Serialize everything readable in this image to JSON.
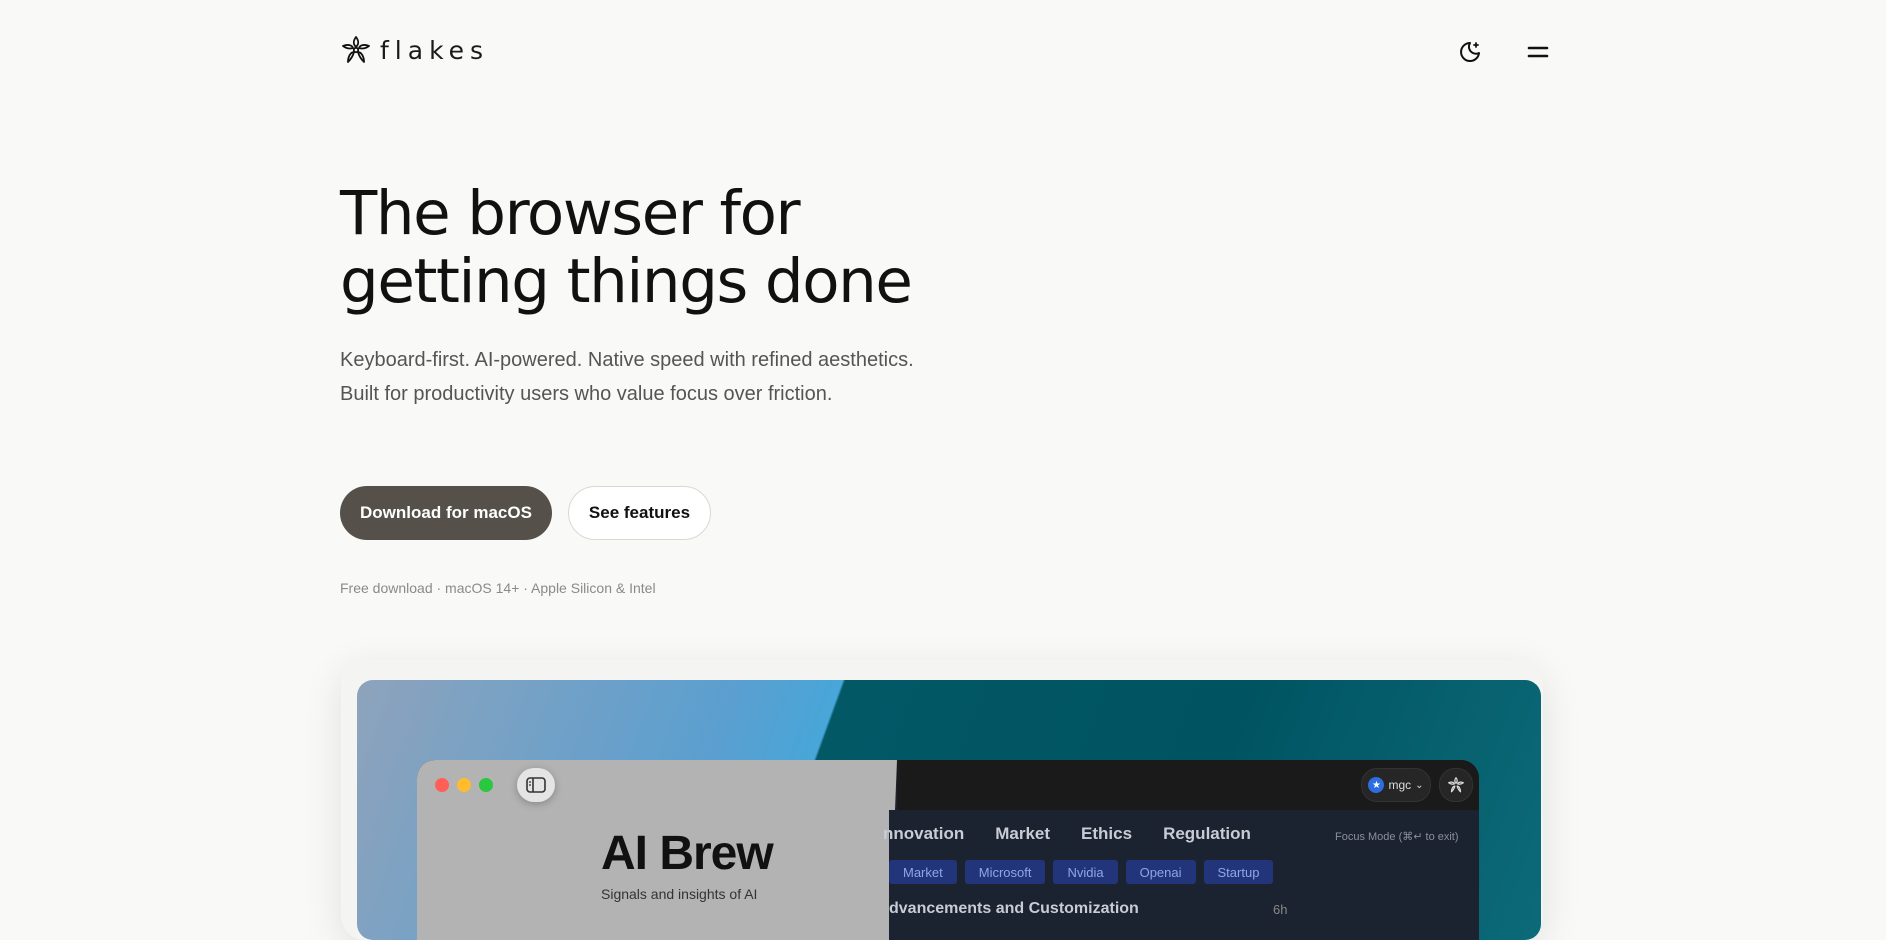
{
  "nav": {
    "brand": "flakes",
    "theme_icon": "moon-sparkle-icon",
    "menu_icon": "menu-icon"
  },
  "hero": {
    "headline_line1": "The browser for",
    "headline_line2": "getting things done",
    "subtext": "Keyboard-first. AI-powered. Native speed with refined aesthetics. Built for productivity users who value focus over friction.",
    "primary_cta": "Download for macOS",
    "secondary_cta": "See features",
    "fineprint": "Free download · macOS 14+ · Apple Silicon & Intel"
  },
  "preview": {
    "page_title": "AI Brew",
    "page_subtitle": "Signals and insights of AI",
    "profile_label": "mgc",
    "categories": [
      "nnovation",
      "Market",
      "Ethics",
      "Regulation"
    ],
    "focus_hint": "Focus Mode (⌘↵ to exit)",
    "tags": [
      "Market",
      "Microsoft",
      "Nvidia",
      "Openai",
      "Startup"
    ],
    "article_title": "dvancements and Customization",
    "article_age": "6h"
  },
  "colors": {
    "page_bg": "#f9f9f7",
    "primary_button": "#555049",
    "tag_bg": "#22357a",
    "teal": "#005462"
  }
}
